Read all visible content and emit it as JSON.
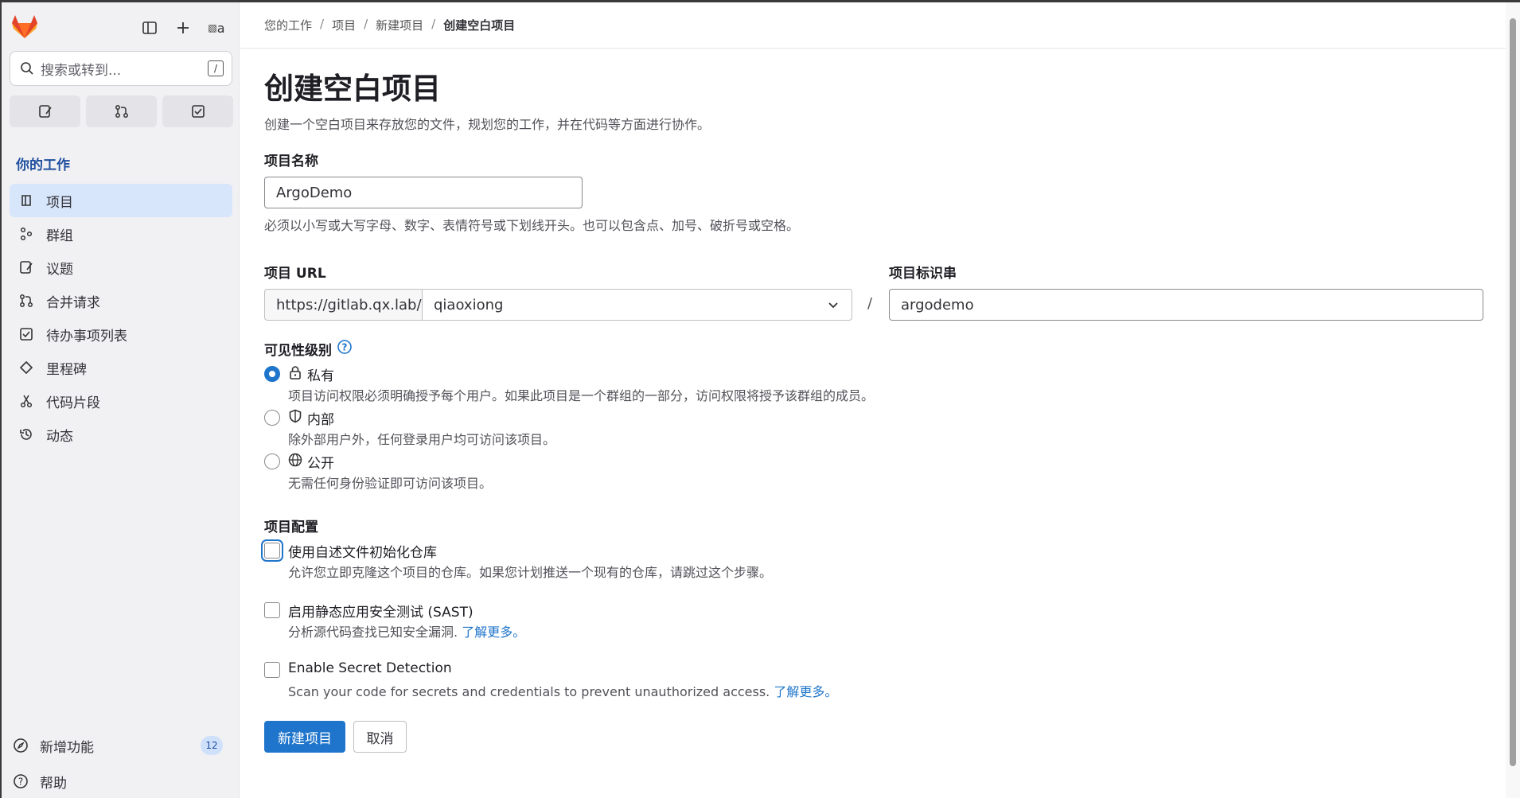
{
  "sidebar": {
    "avatar_alt": "a",
    "search_placeholder": "搜索或转到...",
    "search_kbd": "/",
    "section_title": "你的工作",
    "items": [
      {
        "label": "项目",
        "icon": "project-icon",
        "active": true
      },
      {
        "label": "群组",
        "icon": "group-icon"
      },
      {
        "label": "议题",
        "icon": "issues-icon"
      },
      {
        "label": "合并请求",
        "icon": "merge-request-icon"
      },
      {
        "label": "待办事项列表",
        "icon": "todo-icon"
      },
      {
        "label": "里程碑",
        "icon": "milestone-icon"
      },
      {
        "label": "代码片段",
        "icon": "snippet-icon"
      },
      {
        "label": "动态",
        "icon": "history-icon"
      }
    ],
    "whats_new_label": "新增功能",
    "whats_new_count": "12",
    "help_label": "帮助"
  },
  "breadcrumb": [
    "您的工作",
    "项目",
    "新建项目",
    "创建空白项目"
  ],
  "page": {
    "title": "创建空白项目",
    "description": "创建一个空白项目来存放您的文件，规划您的工作，并在代码等方面进行协作。"
  },
  "form": {
    "name_label": "项目名称",
    "name_value": "ArgoDemo",
    "name_help": "必须以小写或大写字母、数字、表情符号或下划线开头。也可以包含点、加号、破折号或空格。",
    "url_label": "项目 URL",
    "url_prefix": "https://gitlab.qx.lab/",
    "namespace": "qiaoxiong",
    "slash": "/",
    "slug_label": "项目标识串",
    "slug_value": "argodemo",
    "visibility_label": "可见性级别",
    "visibility": [
      {
        "label": "私有",
        "desc": "项目访问权限必须明确授予每个用户。如果此项目是一个群组的一部分，访问权限将授予该群组的成员。",
        "checked": true,
        "icon": "lock-icon"
      },
      {
        "label": "内部",
        "desc": "除外部用户外，任何登录用户均可访问该项目。",
        "checked": false,
        "icon": "shield-icon"
      },
      {
        "label": "公开",
        "desc": "无需任何身份验证即可访问该项目。",
        "checked": false,
        "icon": "globe-icon"
      }
    ],
    "config_label": "项目配置",
    "options": [
      {
        "label": "使用自述文件初始化仓库",
        "desc": "允许您立即克隆这个项目的仓库。如果您计划推送一个现有的仓库，请跳过这个步骤。"
      },
      {
        "label": "启用静态应用安全测试 (SAST)",
        "desc": "分析源代码查找已知安全漏洞.",
        "link": "了解更多。"
      },
      {
        "label": "Enable Secret Detection",
        "desc": "Scan your code for secrets and credentials to prevent unauthorized access.",
        "link": "了解更多。"
      }
    ],
    "submit_label": "新建项目",
    "cancel_label": "取消"
  },
  "colors": {
    "accent": "#1f75cb",
    "sidebar_bg": "#f1f1f3",
    "active_bg": "#d8e6fb"
  }
}
